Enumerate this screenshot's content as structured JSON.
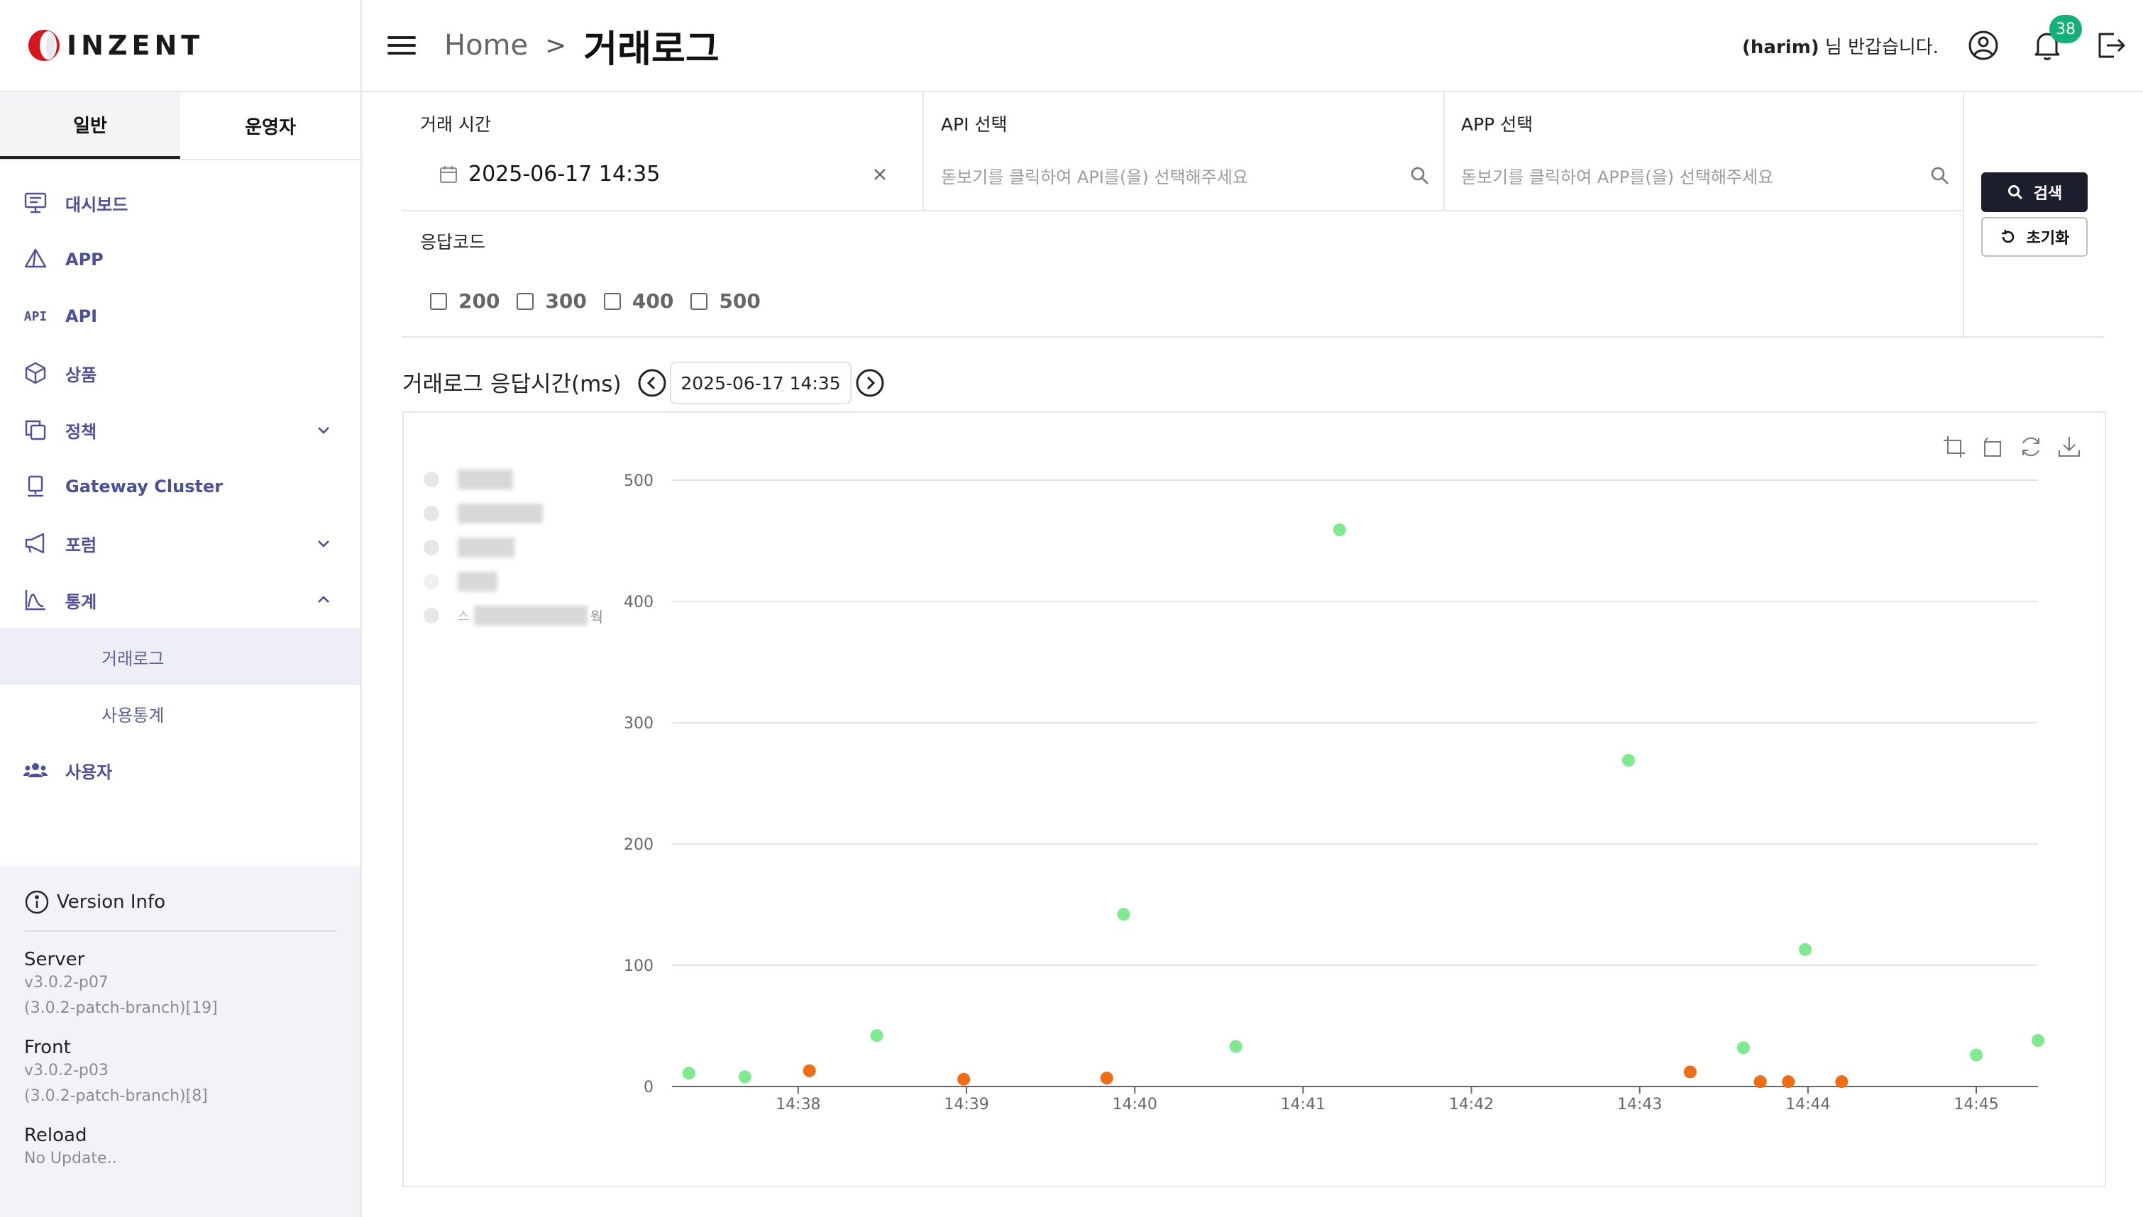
{
  "brand": {
    "name": "INZENT"
  },
  "sidebar": {
    "role_tabs": [
      {
        "label": "일반",
        "active": true
      },
      {
        "label": "운영자",
        "active": false
      }
    ],
    "menu": {
      "dashboard": "대시보드",
      "app": "APP",
      "api": "API",
      "product": "상품",
      "policy": "정책",
      "gateway": "Gateway Cluster",
      "forum": "포럼",
      "stats": "통계",
      "stats_sub": [
        "거래로그",
        "사용통계"
      ],
      "users": "사용자"
    },
    "api_icon_text": "API",
    "version": {
      "title": "Version Info",
      "server_label": "Server",
      "server_ver": "v3.0.2-p07",
      "server_branch": "(3.0.2-patch-branch)[19]",
      "front_label": "Front",
      "front_ver": "v3.0.2-p03",
      "front_branch": "(3.0.2-patch-branch)[8]",
      "reload_label": "Reload",
      "reload_status": "No Update.."
    }
  },
  "header": {
    "home": "Home",
    "sep": ">",
    "current": "거래로그",
    "user_name": "(harim)",
    "greeting_suffix": " 님 반갑습니다.",
    "notification_count": "38"
  },
  "filters": {
    "time_label": "거래 시간",
    "time_value": "2025-06-17 14:35",
    "api_label": "API 선택",
    "api_placeholder": "돋보기를 클릭하여 API를(을) 선택해주세요",
    "app_label": "APP 선택",
    "app_placeholder": "돋보기를 클릭하여 APP를(을) 선택해주세요",
    "code_label": "응답코드",
    "codes": [
      "200",
      "300",
      "400",
      "500"
    ],
    "search_button": "검색",
    "reset_button": "초기화"
  },
  "chart_section": {
    "title": "거래로그 응답시간(ms)",
    "date": "2025-06-17 14:35",
    "legend_partial_text": "웍",
    "legend_partial_prefix": "스"
  },
  "colors": {
    "green": "#7eea8e",
    "orange": "#f36b12",
    "brand_dark": "#1c1e2e",
    "accent": "#4a4fa0",
    "badge": "#14b07a"
  },
  "chart_data": {
    "type": "scatter",
    "title": "거래로그 응답시간(ms)",
    "xlabel": "",
    "ylabel": "",
    "x_unit": "time (HH:MM, 2025-06-17)",
    "xlim": [
      "14:37:15",
      "14:45:22"
    ],
    "ylim": [
      0,
      500
    ],
    "x_ticks": [
      "14:38",
      "14:39",
      "14:40",
      "14:41",
      "14:42",
      "14:43",
      "14:44",
      "14:45"
    ],
    "y_ticks": [
      0,
      100,
      200,
      300,
      400,
      500
    ],
    "grid": true,
    "legend": "top-left (entries obscured)",
    "series": [
      {
        "color": "#7eea8e",
        "points": [
          [
            "14:37:21",
            11
          ],
          [
            "14:37:41",
            8
          ],
          [
            "14:38:28",
            42
          ],
          [
            "14:39:56",
            142
          ],
          [
            "14:40:36",
            33
          ],
          [
            "14:41:13",
            459
          ],
          [
            "14:42:56",
            269
          ],
          [
            "14:43:37",
            32
          ],
          [
            "14:43:59",
            113
          ],
          [
            "14:45:00",
            26
          ],
          [
            "14:45:22",
            38
          ]
        ]
      },
      {
        "color": "#f36b12",
        "points": [
          [
            "14:38:04",
            13
          ],
          [
            "14:38:59",
            6
          ],
          [
            "14:39:50",
            7
          ],
          [
            "14:43:18",
            12
          ],
          [
            "14:43:43",
            4
          ],
          [
            "14:43:53",
            4
          ],
          [
            "14:44:12",
            4
          ]
        ]
      }
    ]
  }
}
